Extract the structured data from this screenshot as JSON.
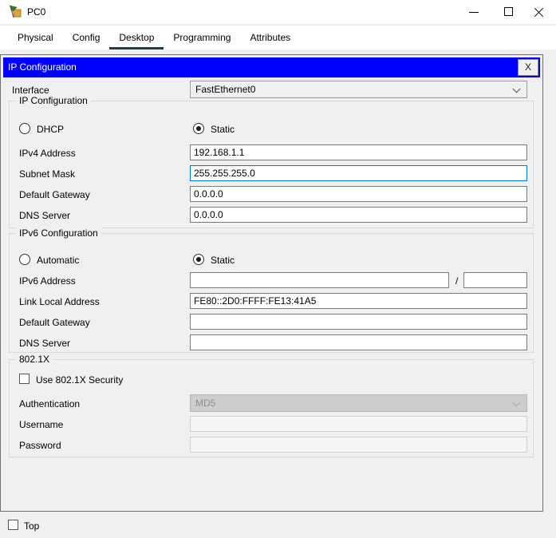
{
  "window": {
    "title": "PC0"
  },
  "tabs": [
    {
      "label": "Physical"
    },
    {
      "label": "Config"
    },
    {
      "label": "Desktop"
    },
    {
      "label": "Programming"
    },
    {
      "label": "Attributes"
    }
  ],
  "selected_tab": "Desktop",
  "dialog": {
    "title": "IP Configuration",
    "close": "X",
    "interface_label": "Interface",
    "interface_value": "FastEthernet0",
    "ipv4": {
      "legend": "IP Configuration",
      "dhcp_label": "DHCP",
      "static_label": "Static",
      "selected_mode": "Static",
      "rows": [
        {
          "label": "IPv4 Address",
          "value": "192.168.1.1"
        },
        {
          "label": "Subnet Mask",
          "value": "255.255.255.0"
        },
        {
          "label": "Default Gateway",
          "value": "0.0.0.0"
        },
        {
          "label": "DNS Server",
          "value": "0.0.0.0"
        }
      ]
    },
    "ipv6": {
      "legend": "IPv6 Configuration",
      "automatic_label": "Automatic",
      "static_label": "Static",
      "selected_mode": "Static",
      "address_label": "IPv6 Address",
      "address_value": "",
      "slash": "/",
      "prefix_value": "",
      "rows": [
        {
          "label": "Link Local Address",
          "value": "FE80::2D0:FFFF:FE13:41A5"
        },
        {
          "label": "Default Gateway",
          "value": ""
        },
        {
          "label": "DNS Server",
          "value": ""
        }
      ]
    },
    "dot1x": {
      "legend": "802.1X",
      "checkbox_label": "Use 802.1X Security",
      "checkbox_checked": false,
      "auth_label": "Authentication",
      "auth_value": "MD5",
      "username_label": "Username",
      "username_value": "",
      "password_label": "Password",
      "password_value": ""
    }
  },
  "footer": {
    "top_label": "Top",
    "top_checked": false
  },
  "colors": {
    "header_blue": "#0000ff",
    "focus_border": "#0078d7",
    "tab_underline": "#1f3a5c",
    "background": "#f0f0f0"
  }
}
